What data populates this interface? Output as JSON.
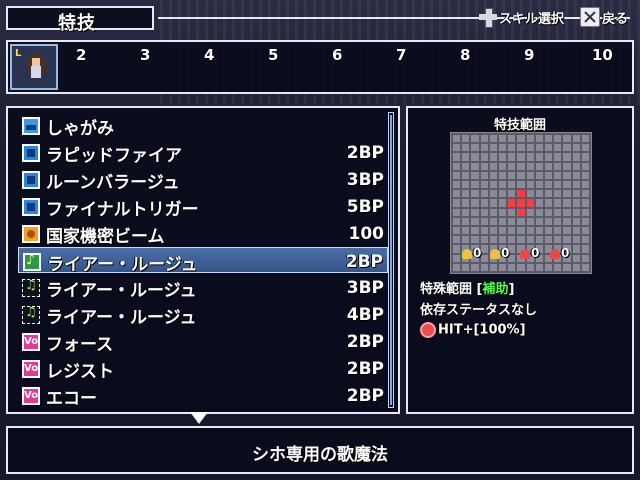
{
  "title": "特技",
  "hints": [
    {
      "label": "スキル選択",
      "icon": "dpad-icon"
    },
    {
      "label": "戻る",
      "icon": "x-button-icon"
    }
  ],
  "party": {
    "level_badge": "L",
    "slots": [
      "2",
      "3",
      "4",
      "5",
      "6",
      "7",
      "8",
      "9",
      "10"
    ]
  },
  "skills": [
    {
      "name": "しゃがみ",
      "cost": "",
      "icon": "crouch-icon"
    },
    {
      "name": "ラピッドファイア",
      "cost": "2BP",
      "icon": "blue-skill-icon"
    },
    {
      "name": "ルーンバラージュ",
      "cost": "3BP",
      "icon": "blue-skill-icon"
    },
    {
      "name": "ファイナルトリガー",
      "cost": "5BP",
      "icon": "blue-skill-icon"
    },
    {
      "name": "国家機密ビーム",
      "cost": "100",
      "icon": "orange-skill-icon"
    },
    {
      "name": "ライアー・ルージュ",
      "cost": "2BP",
      "icon": "song-icon",
      "selected": true
    },
    {
      "name": "ライアー・ルージュ",
      "cost": "3BP",
      "icon": "song-plus-icon"
    },
    {
      "name": "ライアー・ルージュ",
      "cost": "4BP",
      "icon": "song-plus-icon"
    },
    {
      "name": "フォース",
      "cost": "2BP",
      "icon": "vo-icon"
    },
    {
      "name": "レジスト",
      "cost": "2BP",
      "icon": "vo-icon"
    },
    {
      "name": "エコー",
      "cost": "2BP",
      "icon": "vo-icon"
    }
  ],
  "detail": {
    "range_title": "特技範囲",
    "grid_size": 15,
    "highlighted_cells": [
      [
        7,
        7
      ],
      [
        6,
        7
      ],
      [
        8,
        7
      ],
      [
        7,
        6
      ],
      [
        7,
        8
      ]
    ],
    "modifiers": [
      {
        "value": "0",
        "color": "#f0c040"
      },
      {
        "value": "0",
        "color": "#f0c040"
      },
      {
        "value": "0",
        "color": "#e84848"
      },
      {
        "value": "0",
        "color": "#e84848"
      }
    ],
    "special_range_label": "特殊範囲",
    "special_range_open": "[",
    "special_range_value": "補助",
    "special_range_close": "]",
    "dependency": "依存ステータスなし",
    "hit_text": "HIT+[100%]"
  },
  "description": "シホ専用の歌魔法",
  "colors": {
    "highlight_green": "#4cff4c",
    "range_red": "#ff3c3c",
    "selection_blue": "#4a6ea8"
  }
}
